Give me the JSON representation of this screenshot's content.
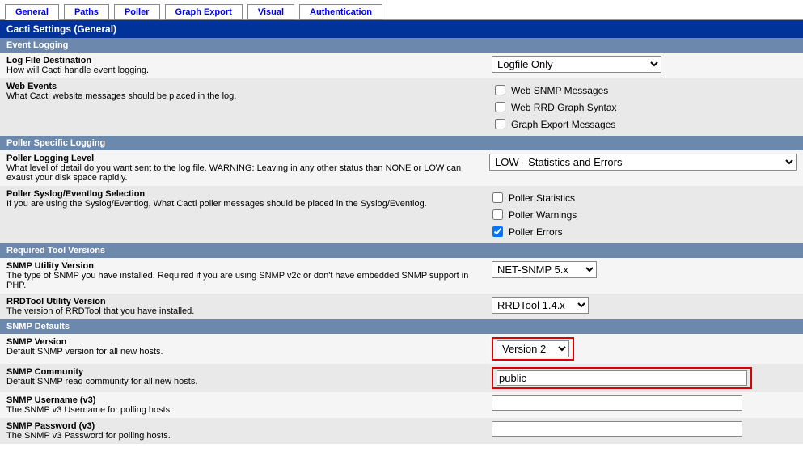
{
  "tabs": {
    "general": "General",
    "paths": "Paths",
    "poller": "Poller",
    "graph_export": "Graph Export",
    "visual": "Visual",
    "authentication": "Authentication"
  },
  "header": "Cacti Settings (General)",
  "sections": {
    "event_logging": "Event Logging",
    "poller_logging": "Poller Specific Logging",
    "required_tools": "Required Tool Versions",
    "snmp_defaults": "SNMP Defaults"
  },
  "fields": {
    "log_dest": {
      "title": "Log File Destination",
      "desc": "How will Cacti handle event logging.",
      "value": "Logfile Only"
    },
    "web_events": {
      "title": "Web Events",
      "desc": "What Cacti website messages should be placed in the log.",
      "opt1": "Web SNMP Messages",
      "opt2": "Web RRD Graph Syntax",
      "opt3": "Graph Export Messages"
    },
    "poller_level": {
      "title": "Poller Logging Level",
      "desc": "What level of detail do you want sent to the log file. WARNING: Leaving in any other status than NONE or LOW can exaust your disk space rapidly.",
      "value": "LOW - Statistics and Errors"
    },
    "poller_syslog": {
      "title": "Poller Syslog/Eventlog Selection",
      "desc": "If you are using the Syslog/Eventlog, What Cacti poller messages should be placed in the Syslog/Eventlog.",
      "opt1": "Poller Statistics",
      "opt2": "Poller Warnings",
      "opt3": "Poller Errors"
    },
    "snmp_util": {
      "title": "SNMP Utility Version",
      "desc": "The type of SNMP you have installed. Required if you are using SNMP v2c or don't have embedded SNMP support in PHP.",
      "value": "NET-SNMP 5.x"
    },
    "rrdtool_util": {
      "title": "RRDTool Utility Version",
      "desc": "The version of RRDTool that you have installed.",
      "value": "RRDTool 1.4.x"
    },
    "snmp_version": {
      "title": "SNMP Version",
      "desc": "Default SNMP version for all new hosts.",
      "value": "Version 2"
    },
    "snmp_community": {
      "title": "SNMP Community",
      "desc": "Default SNMP read community for all new hosts.",
      "value": "public"
    },
    "snmp_username": {
      "title": "SNMP Username (v3)",
      "desc": "The SNMP v3 Username for polling hosts.",
      "value": ""
    },
    "snmp_password": {
      "title": "SNMP Password (v3)",
      "desc": "The SNMP v3 Password for polling hosts.",
      "value": ""
    }
  }
}
